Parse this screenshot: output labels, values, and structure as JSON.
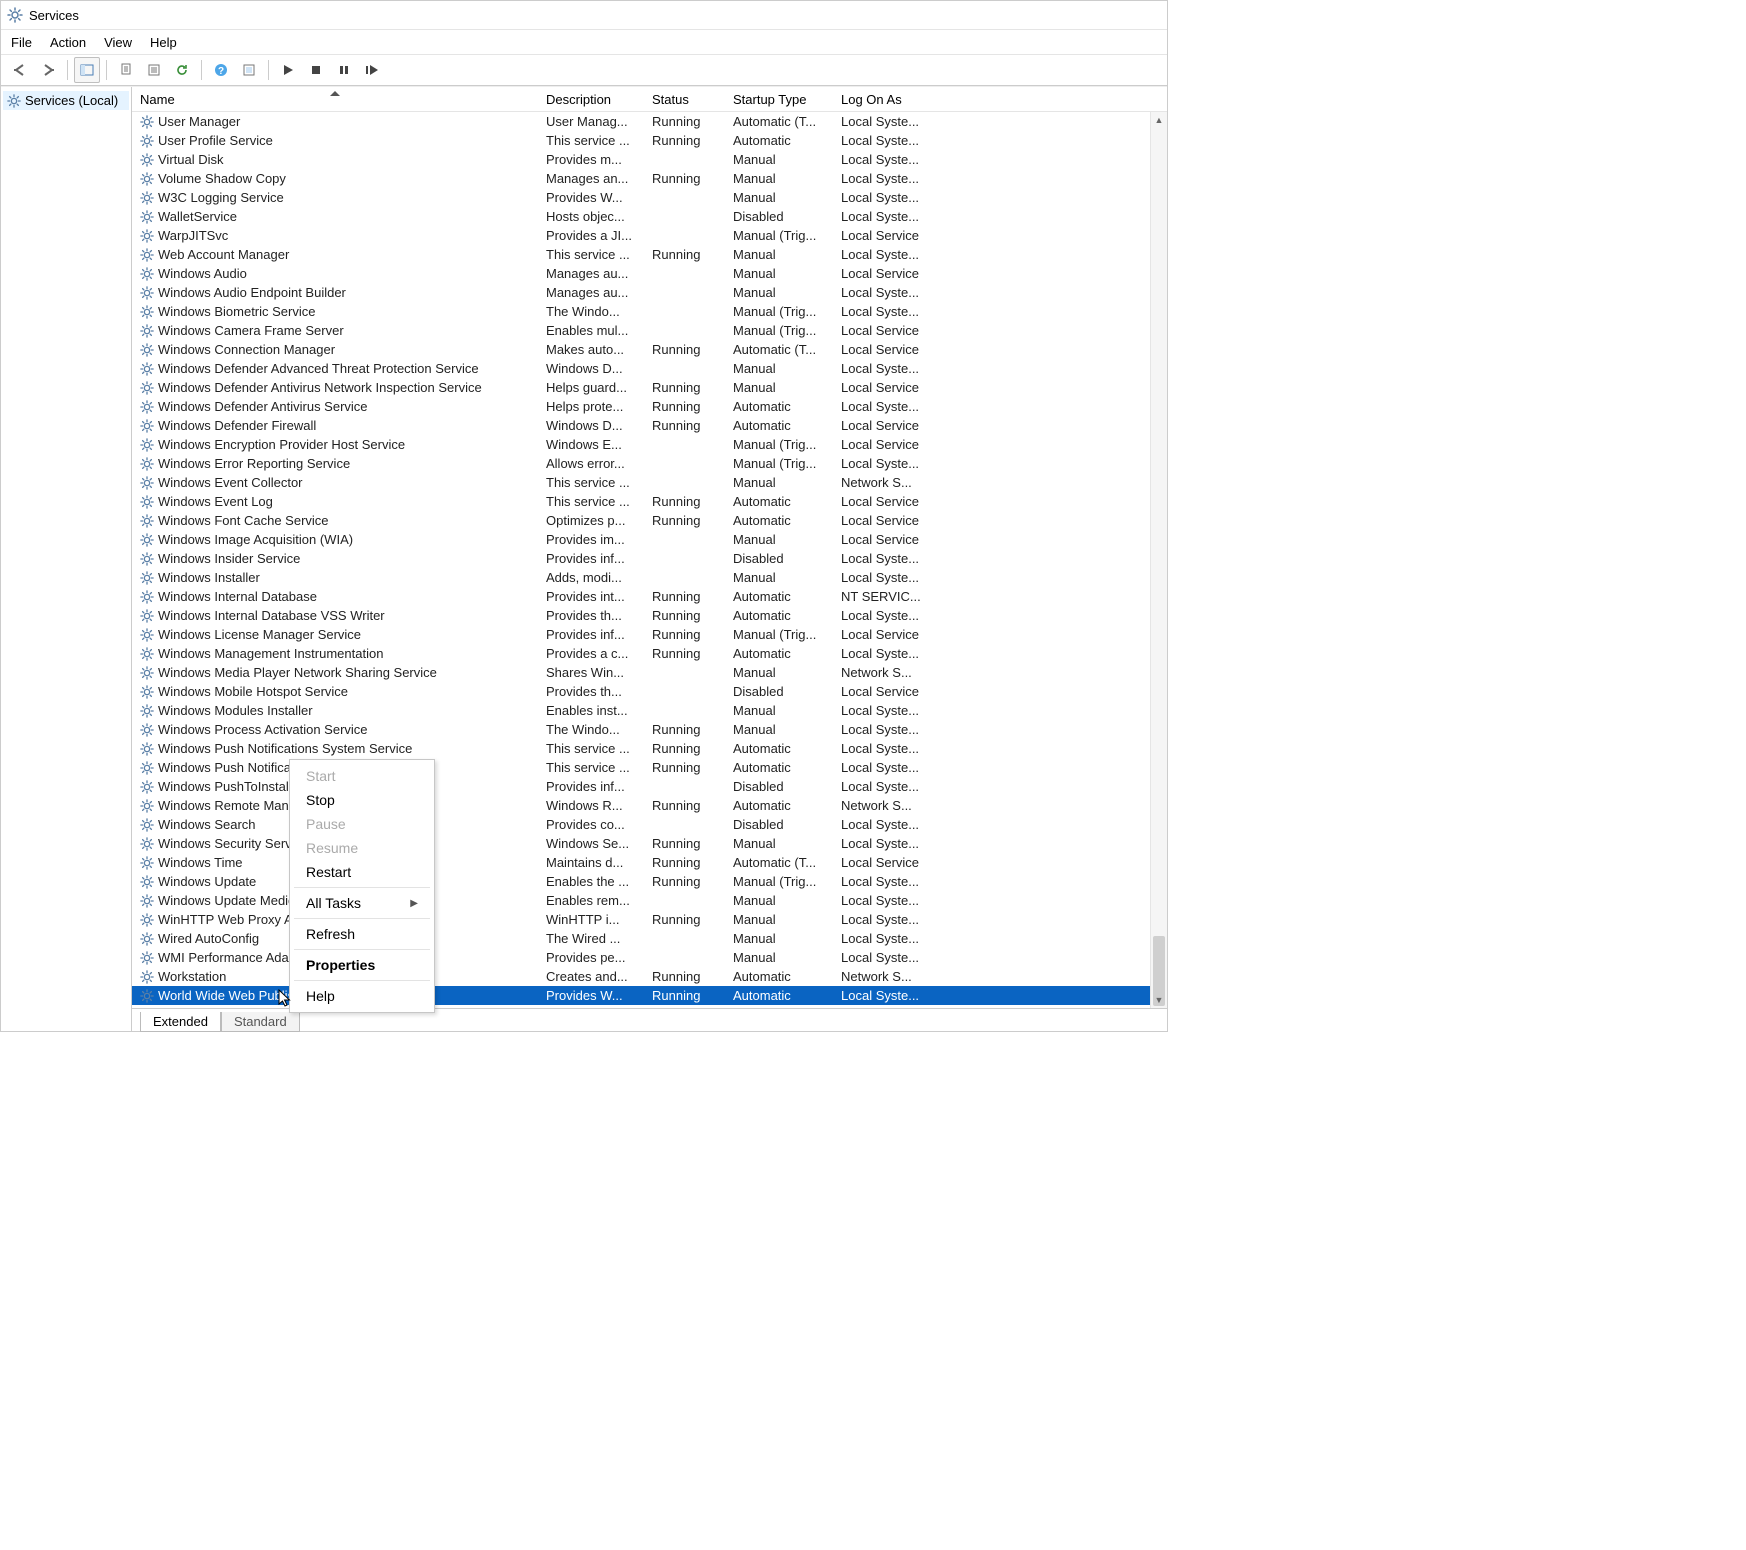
{
  "window": {
    "title": "Services"
  },
  "menu": {
    "file": "File",
    "action": "Action",
    "view": "View",
    "help": "Help"
  },
  "tree": {
    "root": "Services (Local)"
  },
  "columns": {
    "name": "Name",
    "desc": "Description",
    "status": "Status",
    "startup": "Startup Type",
    "logon": "Log On As"
  },
  "tabs": {
    "extended": "Extended",
    "standard": "Standard"
  },
  "context": {
    "start": "Start",
    "stop": "Stop",
    "pause": "Pause",
    "resume": "Resume",
    "restart": "Restart",
    "alltasks": "All Tasks",
    "refresh": "Refresh",
    "properties": "Properties",
    "help": "Help"
  },
  "services": [
    {
      "name": "User Manager",
      "desc": "User Manag...",
      "status": "Running",
      "startup": "Automatic (T...",
      "logon": "Local Syste..."
    },
    {
      "name": "User Profile Service",
      "desc": "This service ...",
      "status": "Running",
      "startup": "Automatic",
      "logon": "Local Syste..."
    },
    {
      "name": "Virtual Disk",
      "desc": "Provides m...",
      "status": "",
      "startup": "Manual",
      "logon": "Local Syste..."
    },
    {
      "name": "Volume Shadow Copy",
      "desc": "Manages an...",
      "status": "Running",
      "startup": "Manual",
      "logon": "Local Syste..."
    },
    {
      "name": "W3C Logging Service",
      "desc": "Provides W...",
      "status": "",
      "startup": "Manual",
      "logon": "Local Syste..."
    },
    {
      "name": "WalletService",
      "desc": "Hosts objec...",
      "status": "",
      "startup": "Disabled",
      "logon": "Local Syste..."
    },
    {
      "name": "WarpJITSvc",
      "desc": "Provides a JI...",
      "status": "",
      "startup": "Manual (Trig...",
      "logon": "Local Service"
    },
    {
      "name": "Web Account Manager",
      "desc": "This service ...",
      "status": "Running",
      "startup": "Manual",
      "logon": "Local Syste..."
    },
    {
      "name": "Windows Audio",
      "desc": "Manages au...",
      "status": "",
      "startup": "Manual",
      "logon": "Local Service"
    },
    {
      "name": "Windows Audio Endpoint Builder",
      "desc": "Manages au...",
      "status": "",
      "startup": "Manual",
      "logon": "Local Syste..."
    },
    {
      "name": "Windows Biometric Service",
      "desc": "The Windo...",
      "status": "",
      "startup": "Manual (Trig...",
      "logon": "Local Syste..."
    },
    {
      "name": "Windows Camera Frame Server",
      "desc": "Enables mul...",
      "status": "",
      "startup": "Manual (Trig...",
      "logon": "Local Service"
    },
    {
      "name": "Windows Connection Manager",
      "desc": "Makes auto...",
      "status": "Running",
      "startup": "Automatic (T...",
      "logon": "Local Service"
    },
    {
      "name": "Windows Defender Advanced Threat Protection Service",
      "desc": "Windows D...",
      "status": "",
      "startup": "Manual",
      "logon": "Local Syste..."
    },
    {
      "name": "Windows Defender Antivirus Network Inspection Service",
      "desc": "Helps guard...",
      "status": "Running",
      "startup": "Manual",
      "logon": "Local Service"
    },
    {
      "name": "Windows Defender Antivirus Service",
      "desc": "Helps prote...",
      "status": "Running",
      "startup": "Automatic",
      "logon": "Local Syste..."
    },
    {
      "name": "Windows Defender Firewall",
      "desc": "Windows D...",
      "status": "Running",
      "startup": "Automatic",
      "logon": "Local Service"
    },
    {
      "name": "Windows Encryption Provider Host Service",
      "desc": "Windows E...",
      "status": "",
      "startup": "Manual (Trig...",
      "logon": "Local Service"
    },
    {
      "name": "Windows Error Reporting Service",
      "desc": "Allows error...",
      "status": "",
      "startup": "Manual (Trig...",
      "logon": "Local Syste..."
    },
    {
      "name": "Windows Event Collector",
      "desc": "This service ...",
      "status": "",
      "startup": "Manual",
      "logon": "Network S..."
    },
    {
      "name": "Windows Event Log",
      "desc": "This service ...",
      "status": "Running",
      "startup": "Automatic",
      "logon": "Local Service"
    },
    {
      "name": "Windows Font Cache Service",
      "desc": "Optimizes p...",
      "status": "Running",
      "startup": "Automatic",
      "logon": "Local Service"
    },
    {
      "name": "Windows Image Acquisition (WIA)",
      "desc": "Provides im...",
      "status": "",
      "startup": "Manual",
      "logon": "Local Service"
    },
    {
      "name": "Windows Insider Service",
      "desc": "Provides inf...",
      "status": "",
      "startup": "Disabled",
      "logon": "Local Syste..."
    },
    {
      "name": "Windows Installer",
      "desc": "Adds, modi...",
      "status": "",
      "startup": "Manual",
      "logon": "Local Syste..."
    },
    {
      "name": "Windows Internal Database",
      "desc": "Provides int...",
      "status": "Running",
      "startup": "Automatic",
      "logon": "NT SERVIC..."
    },
    {
      "name": "Windows Internal Database VSS Writer",
      "desc": "Provides th...",
      "status": "Running",
      "startup": "Automatic",
      "logon": "Local Syste..."
    },
    {
      "name": "Windows License Manager Service",
      "desc": "Provides inf...",
      "status": "Running",
      "startup": "Manual (Trig...",
      "logon": "Local Service"
    },
    {
      "name": "Windows Management Instrumentation",
      "desc": "Provides a c...",
      "status": "Running",
      "startup": "Automatic",
      "logon": "Local Syste..."
    },
    {
      "name": "Windows Media Player Network Sharing Service",
      "desc": "Shares Win...",
      "status": "",
      "startup": "Manual",
      "logon": "Network S..."
    },
    {
      "name": "Windows Mobile Hotspot Service",
      "desc": "Provides th...",
      "status": "",
      "startup": "Disabled",
      "logon": "Local Service"
    },
    {
      "name": "Windows Modules Installer",
      "desc": "Enables inst...",
      "status": "",
      "startup": "Manual",
      "logon": "Local Syste..."
    },
    {
      "name": "Windows Process Activation Service",
      "desc": "The Windo...",
      "status": "Running",
      "startup": "Manual",
      "logon": "Local Syste..."
    },
    {
      "name": "Windows Push Notifications System Service",
      "desc": "This service ...",
      "status": "Running",
      "startup": "Automatic",
      "logon": "Local Syste..."
    },
    {
      "name": "Windows Push Notificati",
      "desc": "This service ...",
      "status": "Running",
      "startup": "Automatic",
      "logon": "Local Syste..."
    },
    {
      "name": "Windows PushToInstall S",
      "desc": "Provides inf...",
      "status": "",
      "startup": "Disabled",
      "logon": "Local Syste..."
    },
    {
      "name": "Windows Remote Manag",
      "desc": "Windows R...",
      "status": "Running",
      "startup": "Automatic",
      "logon": "Network S..."
    },
    {
      "name": "Windows Search",
      "desc": "Provides co...",
      "status": "",
      "startup": "Disabled",
      "logon": "Local Syste..."
    },
    {
      "name": "Windows Security Service",
      "desc": "Windows Se...",
      "status": "Running",
      "startup": "Manual",
      "logon": "Local Syste..."
    },
    {
      "name": "Windows Time",
      "desc": "Maintains d...",
      "status": "Running",
      "startup": "Automatic (T...",
      "logon": "Local Service"
    },
    {
      "name": "Windows Update",
      "desc": "Enables the ...",
      "status": "Running",
      "startup": "Manual (Trig...",
      "logon": "Local Syste..."
    },
    {
      "name": "Windows Update Medic S",
      "desc": "Enables rem...",
      "status": "",
      "startup": "Manual",
      "logon": "Local Syste..."
    },
    {
      "name": "WinHTTP Web Proxy Aut",
      "desc": "WinHTTP i...",
      "status": "Running",
      "startup": "Manual",
      "logon": "Local Syste..."
    },
    {
      "name": "Wired AutoConfig",
      "desc": "The Wired ...",
      "status": "",
      "startup": "Manual",
      "logon": "Local Syste..."
    },
    {
      "name": "WMI Performance Adapt",
      "desc": "Provides pe...",
      "status": "",
      "startup": "Manual",
      "logon": "Local Syste..."
    },
    {
      "name": "Workstation",
      "desc": "Creates and...",
      "status": "Running",
      "startup": "Automatic",
      "logon": "Network S..."
    },
    {
      "name": "World Wide Web Publishing Service",
      "desc": "Provides W...",
      "status": "Running",
      "startup": "Automatic",
      "logon": "Local Syste..."
    }
  ],
  "selected_index": 46
}
